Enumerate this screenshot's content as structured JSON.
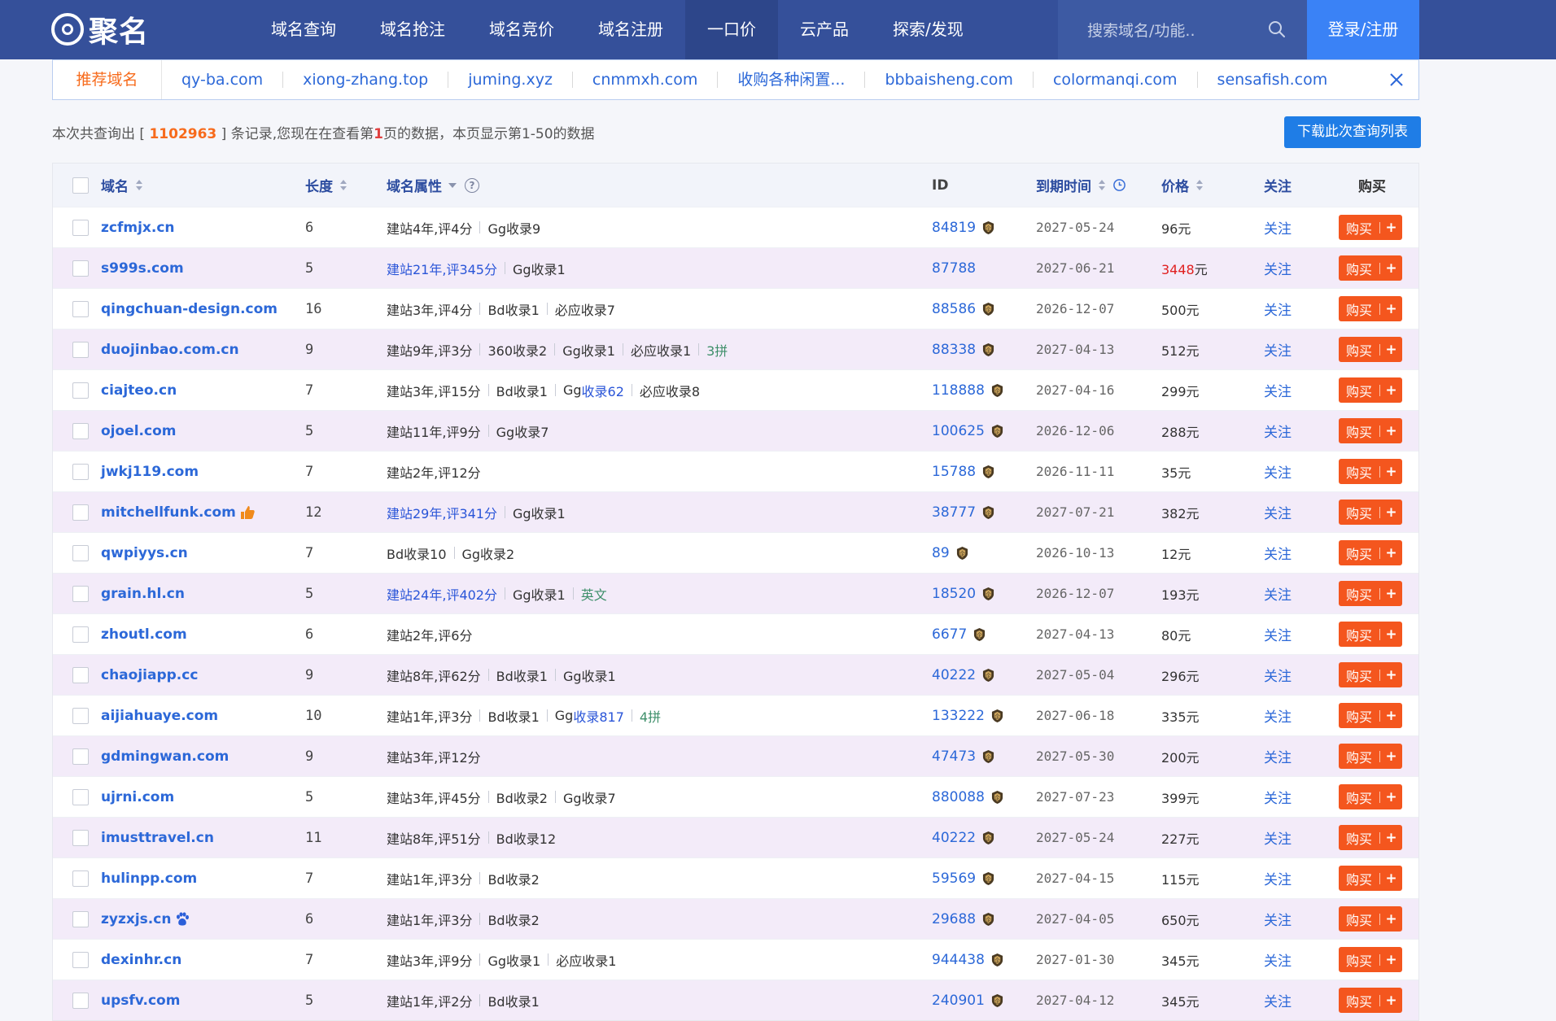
{
  "brand": {
    "name": "聚名"
  },
  "nav": {
    "items": [
      "域名查询",
      "域名抢注",
      "域名竞价",
      "域名注册",
      "一口价",
      "云产品",
      "探索/发现"
    ],
    "active": 4,
    "search_placeholder": "搜索域名/功能..",
    "login_label": "登录/注册"
  },
  "recommend": {
    "title": "推荐域名",
    "items": [
      "qy-ba.com",
      "xiong-zhang.top",
      "juming.xyz",
      "cnmmxh.com",
      "收购各种闲置...",
      "bbbaisheng.com",
      "colormanqi.com",
      "sensafish.com"
    ]
  },
  "summary": {
    "prefix": "本次共查询出 [ ",
    "total": "1102963",
    "middle": " ] 条记录,您现在在查看第",
    "page": "1",
    "suffix": "页的数据，本页显示第1-50的数据"
  },
  "download_label": "下载此次查询列表",
  "columns": {
    "domain": "域名",
    "length": "长度",
    "attr": "域名属性",
    "id": "ID",
    "expire": "到期时间",
    "price": "价格",
    "follow": "关注",
    "buy": "购买"
  },
  "row_actions": {
    "follow": "关注",
    "buy": "购买",
    "plus": "+"
  },
  "rows": [
    {
      "domain": "zcfmjx.cn",
      "len": "6",
      "attrs": [
        {
          "t": "建站4年,评4分"
        },
        {
          "t": "Gg收录9"
        }
      ],
      "id": "84819",
      "exp": "2027-05-24",
      "price": "96",
      "unit": "元"
    },
    {
      "domain": "s999s.com",
      "len": "5",
      "attrs": [
        {
          "t": "建站21年,评345分",
          "c": "blue"
        },
        {
          "t": "Gg收录1"
        }
      ],
      "id": "87788",
      "exp": "2027-06-21",
      "price": "3448",
      "unit": "元",
      "price_red": true,
      "no_badge": true
    },
    {
      "domain": "qingchuan-design.com",
      "len": "16",
      "attrs": [
        {
          "t": "建站3年,评4分"
        },
        {
          "t": "Bd收录1"
        },
        {
          "t": "必应收录7"
        }
      ],
      "id": "88586",
      "exp": "2026-12-07",
      "price": "500",
      "unit": "元"
    },
    {
      "domain": "duojinbao.com.cn",
      "len": "9",
      "attrs": [
        {
          "t": "建站9年,评3分"
        },
        {
          "t": "360收录2"
        },
        {
          "t": "Gg收录1"
        },
        {
          "t": "必应收录1"
        },
        {
          "t": "3拼",
          "c": "green"
        }
      ],
      "id": "88338",
      "exp": "2027-04-13",
      "price": "512",
      "unit": "元"
    },
    {
      "domain": "ciajteo.cn",
      "len": "7",
      "attrs": [
        {
          "t": "建站3年,评15分"
        },
        {
          "t": "Bd收录1"
        },
        {
          "t": "Gg",
          "tail": "收录62"
        },
        {
          "t": "必应收录8"
        }
      ],
      "id": "118888",
      "exp": "2027-04-16",
      "price": "299",
      "unit": "元"
    },
    {
      "domain": "ojoel.com",
      "len": "5",
      "attrs": [
        {
          "t": "建站11年,评9分"
        },
        {
          "t": "Gg收录7"
        }
      ],
      "id": "100625",
      "exp": "2026-12-06",
      "price": "288",
      "unit": "元"
    },
    {
      "domain": "jwkj119.com",
      "len": "7",
      "attrs": [
        {
          "t": "建站2年,评12分"
        }
      ],
      "id": "15788",
      "exp": "2026-11-11",
      "price": "35",
      "unit": "元"
    },
    {
      "domain": "mitchellfunk.com",
      "len": "12",
      "attrs": [
        {
          "t": "建站29年,评341分",
          "c": "blue"
        },
        {
          "t": "Gg收录1"
        }
      ],
      "id": "38777",
      "exp": "2027-07-21",
      "price": "382",
      "unit": "元",
      "icon": "thumb"
    },
    {
      "domain": "qwpiyys.cn",
      "len": "7",
      "attrs": [
        {
          "t": "Bd收录10"
        },
        {
          "t": "Gg收录2"
        }
      ],
      "id": "89",
      "exp": "2026-10-13",
      "price": "12",
      "unit": "元"
    },
    {
      "domain": "grain.hl.cn",
      "len": "5",
      "attrs": [
        {
          "t": "建站24年,评402分",
          "c": "blue"
        },
        {
          "t": "Gg收录1"
        },
        {
          "t": "英文",
          "c": "green"
        }
      ],
      "id": "18520",
      "exp": "2026-12-07",
      "price": "193",
      "unit": "元"
    },
    {
      "domain": "zhoutl.com",
      "len": "6",
      "attrs": [
        {
          "t": "建站2年,评6分"
        }
      ],
      "id": "6677",
      "exp": "2027-04-13",
      "price": "80",
      "unit": "元"
    },
    {
      "domain": "chaojiapp.cc",
      "len": "9",
      "attrs": [
        {
          "t": "建站8年,评62分"
        },
        {
          "t": "Bd收录1"
        },
        {
          "t": "Gg收录1"
        }
      ],
      "id": "40222",
      "exp": "2027-05-04",
      "price": "296",
      "unit": "元"
    },
    {
      "domain": "aijiahuaye.com",
      "len": "10",
      "attrs": [
        {
          "t": "建站1年,评3分"
        },
        {
          "t": "Bd收录1"
        },
        {
          "t": "Gg",
          "tail": "收录817"
        },
        {
          "t": "4拼",
          "c": "green"
        }
      ],
      "id": "133222",
      "exp": "2027-06-18",
      "price": "335",
      "unit": "元"
    },
    {
      "domain": "gdmingwan.com",
      "len": "9",
      "attrs": [
        {
          "t": "建站3年,评12分"
        }
      ],
      "id": "47473",
      "exp": "2027-05-30",
      "price": "200",
      "unit": "元"
    },
    {
      "domain": "ujrni.com",
      "len": "5",
      "attrs": [
        {
          "t": "建站3年,评45分"
        },
        {
          "t": "Bd收录2"
        },
        {
          "t": "Gg收录7"
        }
      ],
      "id": "880088",
      "exp": "2027-07-23",
      "price": "399",
      "unit": "元"
    },
    {
      "domain": "imusttravel.cn",
      "len": "11",
      "attrs": [
        {
          "t": "建站8年,评51分"
        },
        {
          "t": "Bd收录12"
        }
      ],
      "id": "40222",
      "exp": "2027-05-24",
      "price": "227",
      "unit": "元"
    },
    {
      "domain": "hulinpp.com",
      "len": "7",
      "attrs": [
        {
          "t": "建站1年,评3分"
        },
        {
          "t": "Bd收录2"
        }
      ],
      "id": "59569",
      "exp": "2027-04-15",
      "price": "115",
      "unit": "元"
    },
    {
      "domain": "zyzxjs.cn",
      "len": "6",
      "attrs": [
        {
          "t": "建站1年,评3分"
        },
        {
          "t": "Bd收录2"
        }
      ],
      "id": "29688",
      "exp": "2027-04-05",
      "price": "650",
      "unit": "元",
      "icon": "paw"
    },
    {
      "domain": "dexinhr.cn",
      "len": "7",
      "attrs": [
        {
          "t": "建站3年,评9分"
        },
        {
          "t": "Gg收录1"
        },
        {
          "t": "必应收录1"
        }
      ],
      "id": "944438",
      "exp": "2027-01-30",
      "price": "345",
      "unit": "元"
    },
    {
      "domain": "upsfv.com",
      "len": "5",
      "attrs": [
        {
          "t": "建站1年,评2分"
        },
        {
          "t": "Bd收录1"
        }
      ],
      "id": "240901",
      "exp": "2027-04-12",
      "price": "345",
      "unit": "元"
    }
  ],
  "colors": {
    "nav_bg": "#35509a",
    "login_bg": "#3a82f6",
    "buy_bg": "#f4561e",
    "link": "#2c68d8",
    "accent_orange": "#f76b1c",
    "row_alt": "#f3ebf9"
  },
  "icons": {
    "search": "search-icon",
    "close": "close-icon",
    "help": "help-icon",
    "clock": "clock-icon",
    "badge": "enterprise-badge-icon",
    "thumb": "thumb-up-icon",
    "paw": "baidu-paw-icon"
  }
}
